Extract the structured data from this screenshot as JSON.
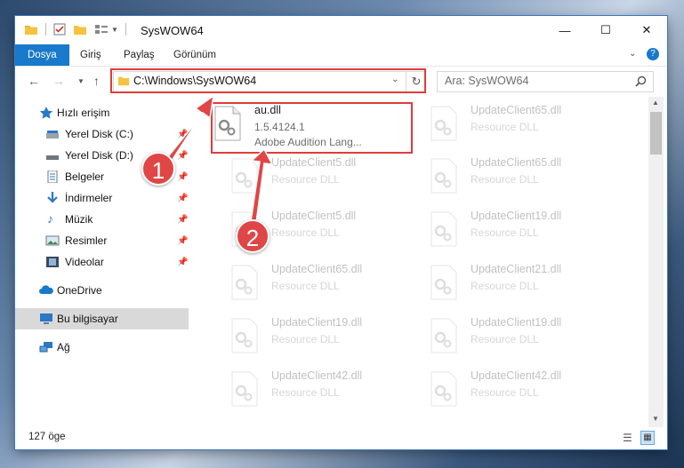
{
  "window": {
    "title": "SysWOW64"
  },
  "ribbon": {
    "tabs": [
      "Dosya",
      "Giriş",
      "Paylaş",
      "Görünüm"
    ]
  },
  "address": {
    "path": "C:\\Windows\\SysWOW64"
  },
  "search": {
    "placeholder": "Ara: SysWOW64"
  },
  "sidebar": {
    "items": [
      {
        "label": "Hızlı erişim",
        "icon": "star-icon"
      },
      {
        "label": "Yerel Disk (C:)",
        "icon": "drive-icon"
      },
      {
        "label": "Yerel Disk (D:)",
        "icon": "drive-icon"
      },
      {
        "label": "Belgeler",
        "icon": "documents-icon"
      },
      {
        "label": "İndirmeler",
        "icon": "download-icon"
      },
      {
        "label": "Müzik",
        "icon": "music-icon"
      },
      {
        "label": "Resimler",
        "icon": "pictures-icon"
      },
      {
        "label": "Videolar",
        "icon": "videos-icon"
      },
      {
        "label": "OneDrive",
        "icon": "cloud-icon"
      },
      {
        "label": "Bu bilgisayar",
        "icon": "computer-icon"
      },
      {
        "label": "Ağ",
        "icon": "network-icon"
      }
    ]
  },
  "files": [
    {
      "name": "au.dll",
      "line2": "1.5.4124.1",
      "line3": "Adobe Audition Lang..."
    },
    {
      "name": "UpdateClient65.dll",
      "line2": "Resource DLL"
    },
    {
      "name": "UpdateClient5.dll",
      "line2": "Resource DLL"
    },
    {
      "name": "UpdateClient65.dll",
      "line2": "Resource DLL"
    },
    {
      "name": "UpdateClient5.dll",
      "line2": "Resource DLL"
    },
    {
      "name": "UpdateClient19.dll",
      "line2": "Resource DLL"
    },
    {
      "name": "UpdateClient65.dll",
      "line2": "Resource DLL"
    },
    {
      "name": "UpdateClient21.dll",
      "line2": "Resource DLL"
    },
    {
      "name": "UpdateClient19.dll",
      "line2": "Resource DLL"
    },
    {
      "name": "UpdateClient19.dll",
      "line2": "Resource DLL"
    },
    {
      "name": "UpdateClient42.dll",
      "line2": "Resource DLL"
    },
    {
      "name": "UpdateClient42.dll",
      "line2": "Resource DLL"
    }
  ],
  "status": {
    "count": "127 öge"
  },
  "annotations": {
    "badge1": "1",
    "badge2": "2"
  },
  "colors": {
    "accent": "#1979ca",
    "highlight": "#e23b3b"
  }
}
